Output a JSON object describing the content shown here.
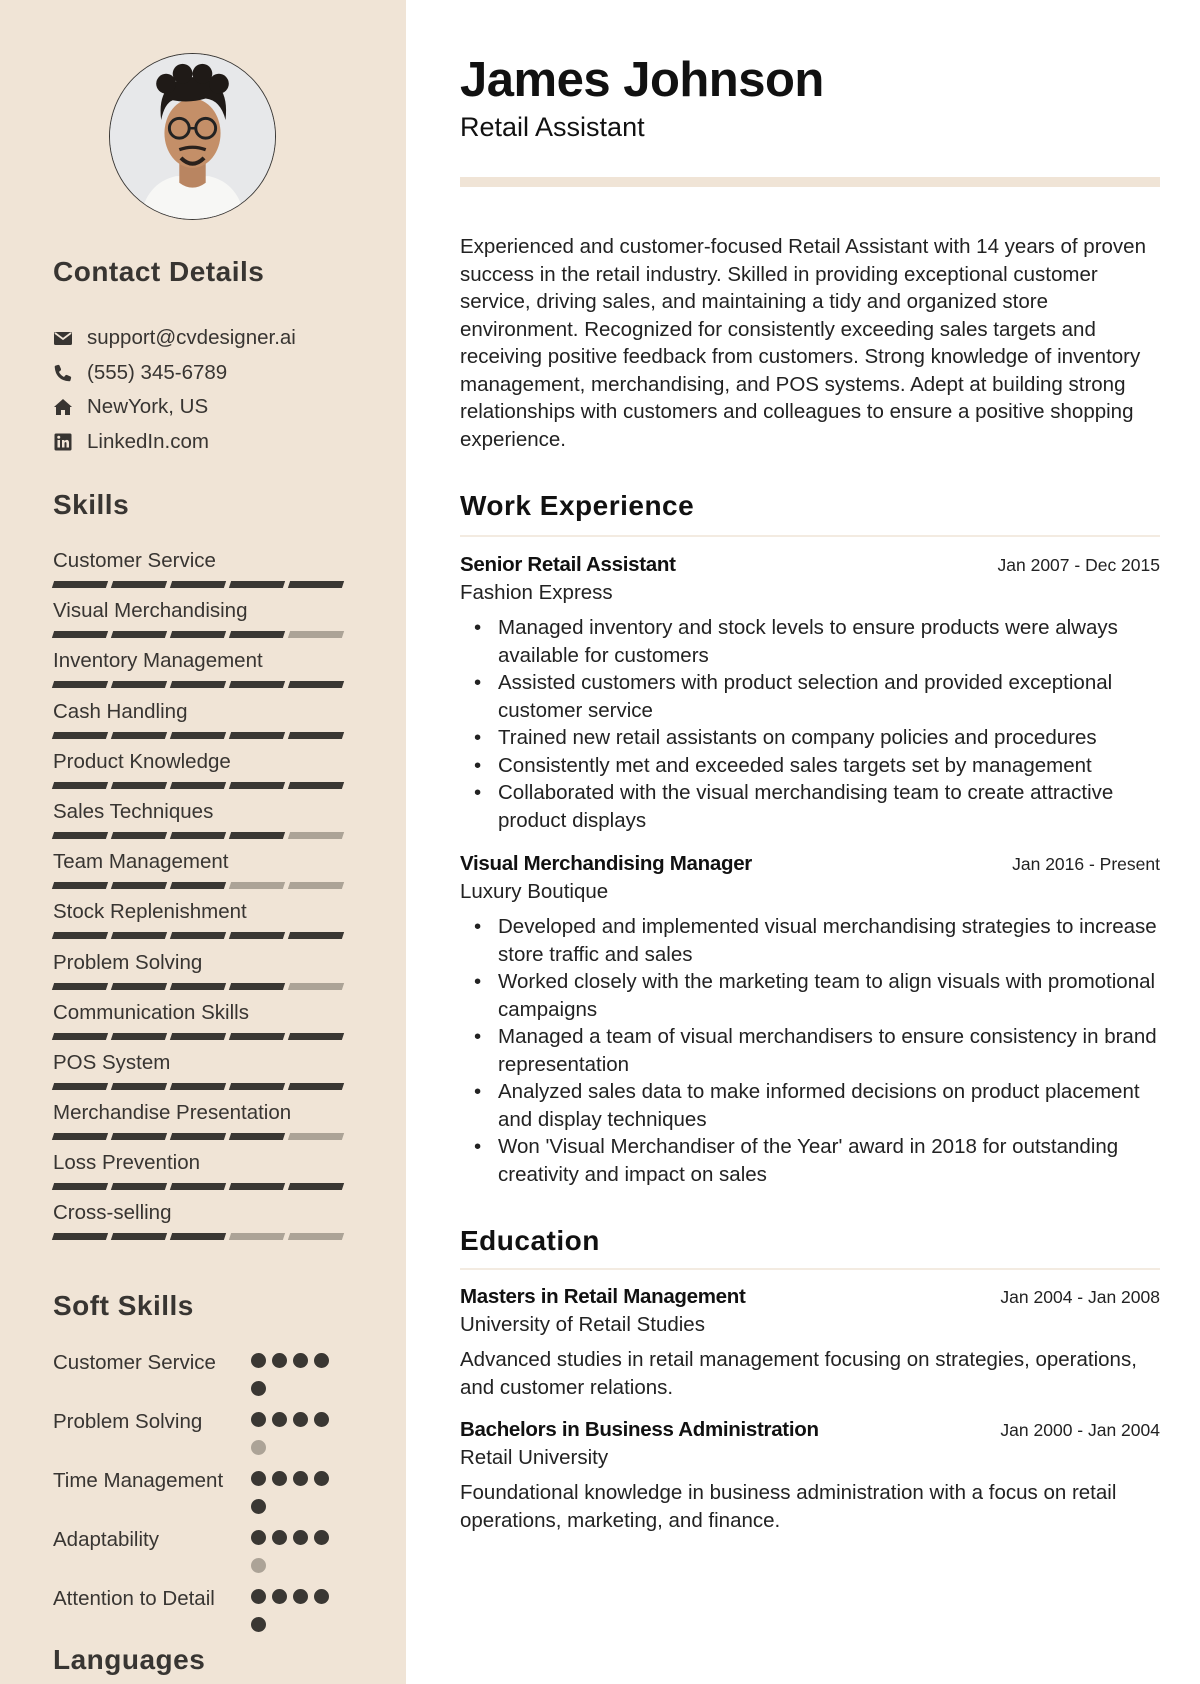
{
  "profile": {
    "name": "James Johnson",
    "title": "Retail Assistant",
    "photo_alt": "profile-photo"
  },
  "colors": {
    "sidebar_bg": "#f0e4d6",
    "accent": "#f0e4d6",
    "bar_filled": "#3a3733",
    "bar_empty": "#aca397"
  },
  "contact": {
    "heading": "Contact Details",
    "items": [
      {
        "icon": "envelope-icon",
        "text": "support@cvdesigner.ai"
      },
      {
        "icon": "phone-icon",
        "text": "(555) 345-6789"
      },
      {
        "icon": "home-icon",
        "text": "NewYork, US"
      },
      {
        "icon": "linkedin-icon",
        "text": "LinkedIn.com"
      }
    ]
  },
  "skills": {
    "heading": "Skills",
    "max": 5,
    "items": [
      {
        "name": "Customer Service",
        "level": 5
      },
      {
        "name": "Visual Merchandising",
        "level": 4
      },
      {
        "name": "Inventory Management",
        "level": 5
      },
      {
        "name": "Cash Handling",
        "level": 5
      },
      {
        "name": "Product Knowledge",
        "level": 5
      },
      {
        "name": "Sales Techniques",
        "level": 4
      },
      {
        "name": "Team Management",
        "level": 3
      },
      {
        "name": "Stock Replenishment",
        "level": 5
      },
      {
        "name": "Problem Solving",
        "level": 4
      },
      {
        "name": "Communication Skills",
        "level": 5
      },
      {
        "name": "POS System",
        "level": 5
      },
      {
        "name": "Merchandise Presentation",
        "level": 4
      },
      {
        "name": "Loss Prevention",
        "level": 5
      },
      {
        "name": "Cross-selling",
        "level": 3
      }
    ]
  },
  "soft_skills": {
    "heading": "Soft Skills",
    "max": 5,
    "items": [
      {
        "name": "Customer Service",
        "level": 5
      },
      {
        "name": "Problem Solving",
        "level": 4
      },
      {
        "name": "Time Management",
        "level": 5
      },
      {
        "name": "Adaptability",
        "level": 4
      },
      {
        "name": "Attention to Detail",
        "level": 5
      }
    ]
  },
  "languages": {
    "heading": "Languages"
  },
  "summary": "Experienced and customer-focused Retail Assistant with 14 years of proven success in the retail industry. Skilled in providing exceptional customer service, driving sales, and maintaining a tidy and organized store environment. Recognized for consistently exceeding sales targets and receiving positive feedback from customers. Strong knowledge of inventory management, merchandising, and POS systems. Adept at building strong relationships with customers and colleagues to ensure a positive shopping experience.",
  "work": {
    "heading": "Work Experience",
    "jobs": [
      {
        "title": "Senior Retail Assistant",
        "dates": "Jan 2007 - Dec 2015",
        "company": "Fashion Express",
        "bullets": [
          "Managed inventory and stock levels to ensure products were always available for customers",
          "Assisted customers with product selection and provided exceptional customer service",
          "Trained new retail assistants on company policies and procedures",
          "Consistently met and exceeded sales targets set by management",
          "Collaborated with the visual merchandising team to create attractive product displays"
        ]
      },
      {
        "title": "Visual Merchandising Manager",
        "dates": "Jan 2016 - Present",
        "company": "Luxury Boutique",
        "bullets": [
          "Developed and implemented visual merchandising strategies to increase store traffic and sales",
          "Worked closely with the marketing team to align visuals with promotional campaigns",
          "Managed a team of visual merchandisers to ensure consistency in brand representation",
          "Analyzed sales data to make informed decisions on product placement and display techniques",
          "Won 'Visual Merchandiser of the Year' award in 2018 for outstanding creativity and impact on sales"
        ]
      }
    ]
  },
  "education": {
    "heading": "Education",
    "items": [
      {
        "degree": "Masters in Retail Management",
        "dates": "Jan 2004 - Jan 2008",
        "school": "University of Retail Studies",
        "description": "Advanced studies in retail management focusing on strategies, operations, and customer relations."
      },
      {
        "degree": "Bachelors in Business Administration",
        "dates": "Jan 2000 - Jan 2004",
        "school": "Retail University",
        "description": "Foundational knowledge in business administration with a focus on retail operations, marketing, and finance."
      }
    ]
  }
}
